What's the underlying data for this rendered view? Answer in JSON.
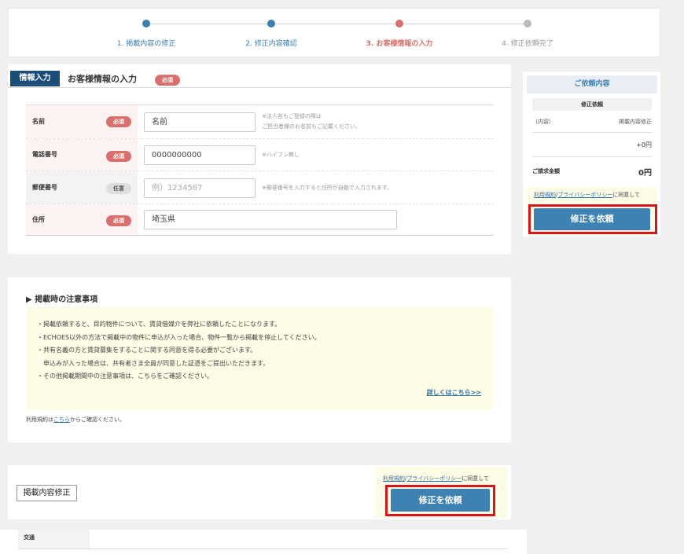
{
  "stepper": {
    "steps": [
      {
        "label": "1. 掲載内容の修正",
        "color": "#3d7eb0"
      },
      {
        "label": "2. 修正内容確認",
        "color": "#3d7eb0"
      },
      {
        "label": "3. お客様情報の入力",
        "color": "#d9706d"
      },
      {
        "label": "4. 修正依頼完了",
        "color": "#aaaaaa"
      }
    ]
  },
  "form": {
    "tag": "情報入力",
    "title": "お客様情報の入力",
    "required_badge": "必須",
    "optional_badge": "任意",
    "fields": [
      {
        "label": "名前",
        "badge": "必須",
        "value": "名前",
        "note": "※法人名もご登録の際は\nご担当者様のお名前もご記載ください。"
      },
      {
        "label": "電話番号",
        "badge": "必須",
        "value": "0000000000",
        "note": "※ハイフン無し"
      },
      {
        "label": "郵便番号",
        "badge": "任意",
        "placeholder": "例）1234567",
        "note": "※郵便番号を入力すると住所が自動で入力されます。"
      },
      {
        "label": "住所",
        "badge": "必須",
        "value": "埼玉県"
      }
    ]
  },
  "notice": {
    "title": "▶ 掲載時の注意事項",
    "items": [
      "・掲載依頼すると、目的物件について、賃貸借媒介を弊社に依頼したことになります。",
      "・ECHOES以外の方法で掲載中の物件に申込が入った場合、物件一覧から掲載を停止してください。",
      "・共有名義の方と賃貸募集をすることに関する同意を得る必要がございます。",
      "　申込みが入った場合は、共有者さま全員が同意した証憑をご提出いただきます。",
      "・その他掲載期間中の注意事項は、こちらをご確認ください。"
    ],
    "more_link": "詳しくはこちら>>",
    "terms_prefix": "利用規約は",
    "terms_link": "こちら",
    "terms_suffix": "からご確認ください。"
  },
  "bottom": {
    "edit_button": "掲載内容修正",
    "agree_link1": "利用規約",
    "agree_sep": "/",
    "agree_link2": "プライバシーポリシー",
    "agree_suffix": "に同意して",
    "submit_button": "修正を依頼"
  },
  "peek": {
    "label": "交通"
  },
  "summary": {
    "title": "ご依頼内容",
    "section": "修正依頼",
    "content_label": "（内容）",
    "content_value": "掲載内容修正",
    "subtotal": "+0円",
    "total_label": "ご請求金額",
    "total_value": "0円",
    "agree_link1": "利用規約",
    "agree_sep": "/",
    "agree_link2": "プライバシーポリシー",
    "agree_suffix": "に同意して",
    "submit_button": "修正を依頼"
  },
  "colors": {
    "accent_blue": "#3e82b4",
    "required_red": "#d9706d",
    "highlight_red": "#d6161d",
    "notice_bg": "#fdfce6"
  }
}
